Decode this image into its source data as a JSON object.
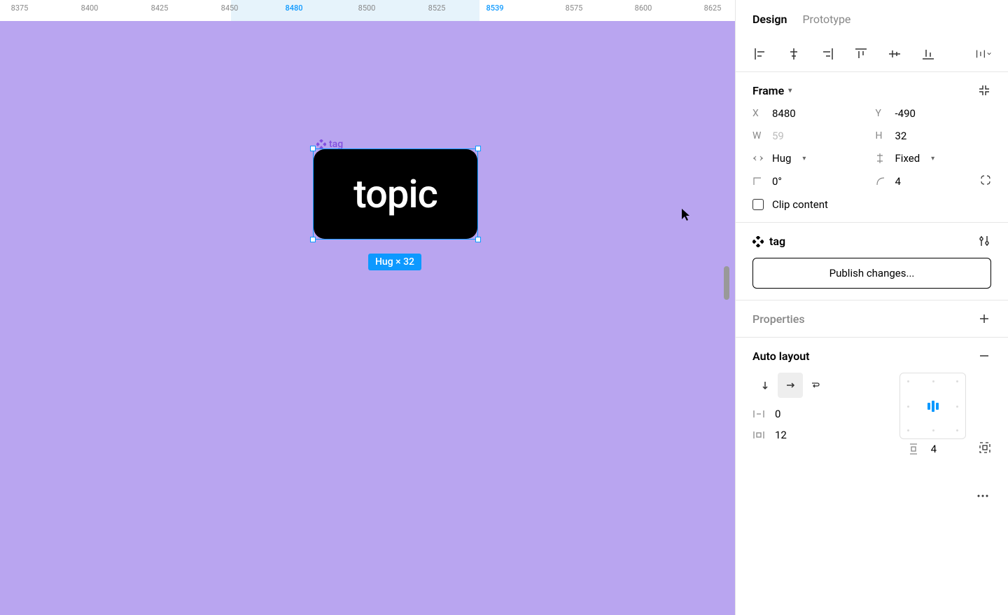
{
  "ruler": {
    "ticks": [
      {
        "label": "8375",
        "pos": 28,
        "blue": false
      },
      {
        "label": "8400",
        "pos": 128,
        "blue": false
      },
      {
        "label": "8425",
        "pos": 228,
        "blue": false
      },
      {
        "label": "8450",
        "pos": 328,
        "blue": false
      },
      {
        "label": "8480",
        "pos": 420,
        "blue": true
      },
      {
        "label": "8500",
        "pos": 524,
        "blue": false
      },
      {
        "label": "8525",
        "pos": 624,
        "blue": false
      },
      {
        "label": "8539",
        "pos": 707,
        "blue": true
      },
      {
        "label": "8575",
        "pos": 820,
        "blue": false
      },
      {
        "label": "8600",
        "pos": 919,
        "blue": false
      },
      {
        "label": "8625",
        "pos": 1018,
        "blue": false
      }
    ]
  },
  "canvas": {
    "element_label": "tag",
    "element_text": "topic",
    "size_badge": "Hug × 32"
  },
  "panel": {
    "tabs": {
      "design": "Design",
      "prototype": "Prototype",
      "active": "design"
    },
    "frame": {
      "title": "Frame",
      "x_label": "X",
      "x_value": "8480",
      "y_label": "Y",
      "y_value": "-490",
      "w_label": "W",
      "w_value": "59",
      "h_label": "H",
      "h_value": "32",
      "horiz_constraint": "Hug",
      "vert_constraint": "Fixed",
      "rotation": "0°",
      "radius": "4",
      "clip_label": "Clip content"
    },
    "component": {
      "name": "tag",
      "publish_label": "Publish changes..."
    },
    "properties": {
      "title": "Properties"
    },
    "autolayout": {
      "title": "Auto layout",
      "gap": "0",
      "pad_h": "12",
      "pad_v": "4"
    }
  }
}
